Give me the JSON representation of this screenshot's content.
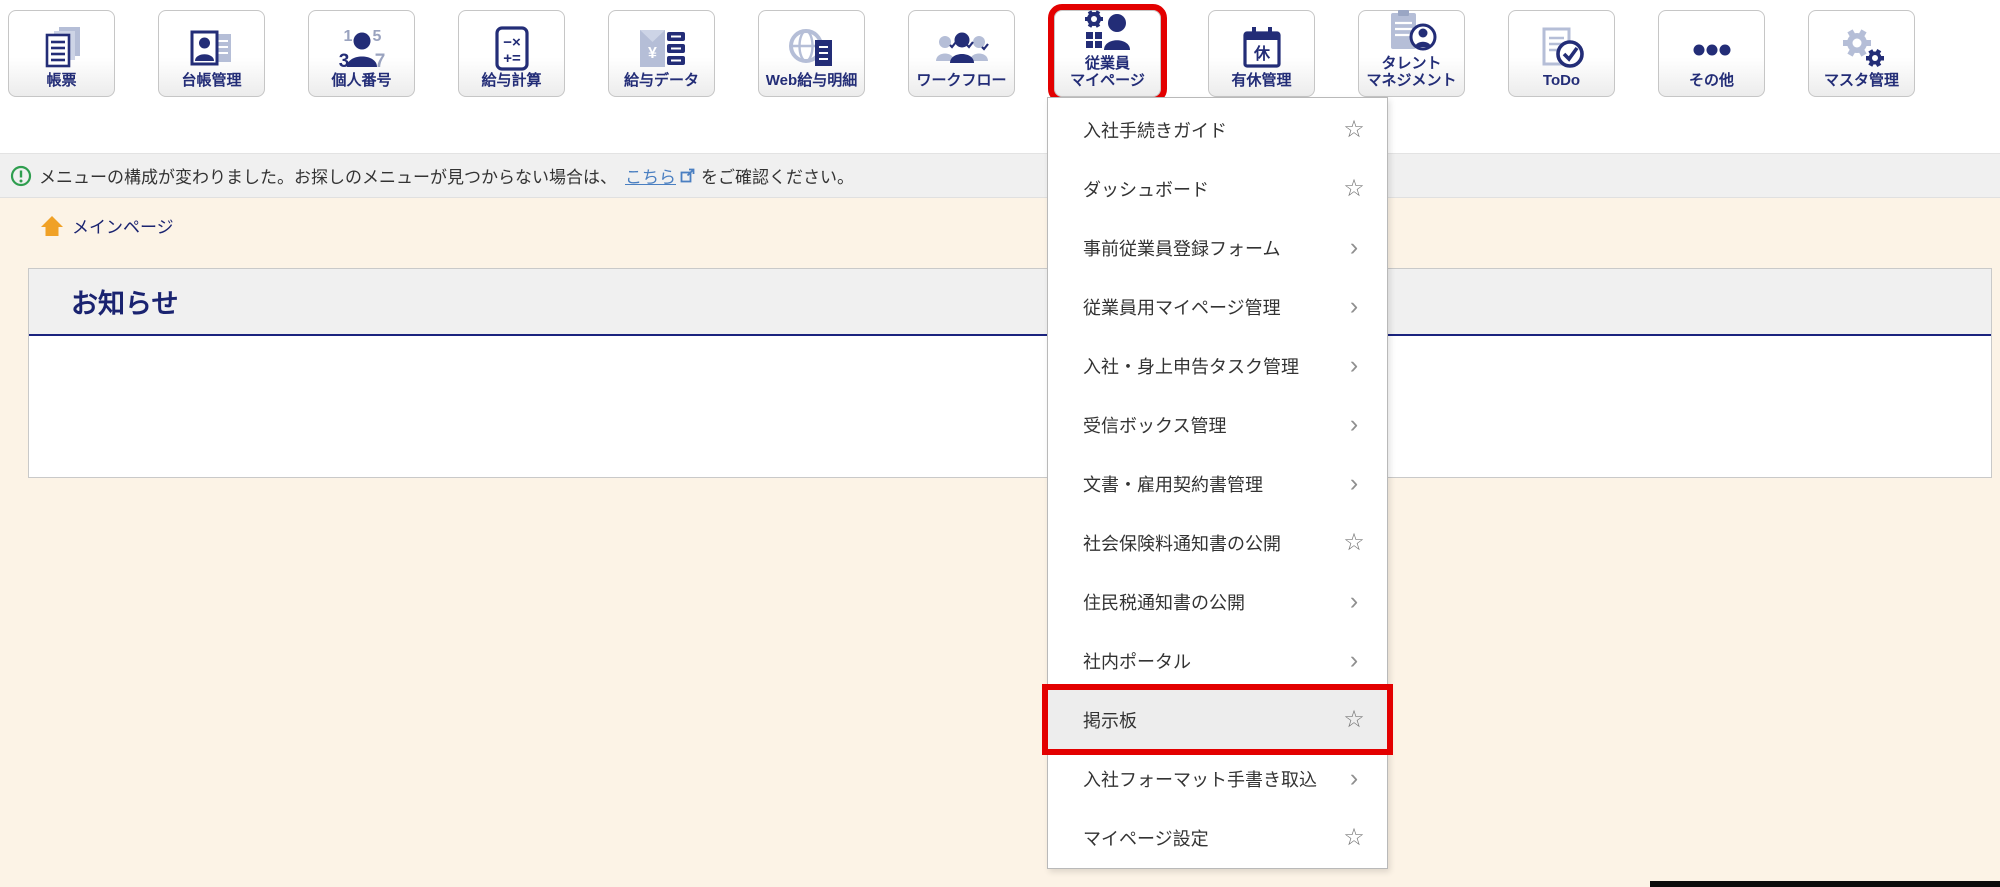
{
  "toolbar": {
    "buttons": [
      {
        "label": "帳票",
        "icon": "documents-icon"
      },
      {
        "label": "台帳管理",
        "icon": "ledger-icon"
      },
      {
        "label": "個人番号",
        "icon": "my-number-icon"
      },
      {
        "label": "給与計算",
        "icon": "calculator-icon"
      },
      {
        "label": "給与データ",
        "icon": "payroll-data-icon"
      },
      {
        "label": "Web給与明細",
        "icon": "web-payslip-icon"
      },
      {
        "label": "ワークフロー",
        "icon": "workflow-icon"
      },
      {
        "label": "従業員\nマイページ",
        "icon": "employee-mypage-icon",
        "selected": true
      },
      {
        "label": "有休管理",
        "icon": "leave-calendar-icon"
      },
      {
        "label": "タレント\nマネジメント",
        "icon": "talent-icon"
      },
      {
        "label": "ToDo",
        "icon": "todo-icon"
      },
      {
        "label": "その他",
        "icon": "more-dots-icon"
      },
      {
        "label": "マスタ管理",
        "icon": "master-gear-icon"
      }
    ]
  },
  "notification": {
    "text_before_link": "メニューの構成が変わりました。お探しのメニューが見つからない場合は、",
    "link_label": "こちら",
    "text_after_link": "をご確認ください。"
  },
  "breadcrumb": {
    "label": "メインページ"
  },
  "main": {
    "section_title": "お知らせ"
  },
  "dropdown": {
    "items": [
      {
        "label": "入社手続きガイド",
        "trailing_glyph": "☆",
        "type": "favorite"
      },
      {
        "label": "ダッシュボード",
        "trailing_glyph": "☆",
        "type": "favorite"
      },
      {
        "label": "事前従業員登録フォーム",
        "trailing_glyph": "›",
        "type": "submenu"
      },
      {
        "label": "従業員用マイページ管理",
        "trailing_glyph": "›",
        "type": "submenu"
      },
      {
        "label": "入社・身上申告タスク管理",
        "trailing_glyph": "›",
        "type": "submenu"
      },
      {
        "label": "受信ボックス管理",
        "trailing_glyph": "›",
        "type": "submenu"
      },
      {
        "label": "文書・雇用契約書管理",
        "trailing_glyph": "›",
        "type": "submenu"
      },
      {
        "label": "社会保険料通知書の公開",
        "trailing_glyph": "☆",
        "type": "favorite"
      },
      {
        "label": "住民税通知書の公開",
        "trailing_glyph": "›",
        "type": "submenu"
      },
      {
        "label": "社内ポータル",
        "trailing_glyph": "›",
        "type": "submenu"
      },
      {
        "label": "掲示板",
        "trailing_glyph": "☆",
        "type": "favorite",
        "highlighted": true
      },
      {
        "label": "入社フォーマット手書き取込",
        "trailing_glyph": "›",
        "type": "submenu"
      },
      {
        "label": "マイページ設定",
        "trailing_glyph": "☆",
        "type": "favorite"
      }
    ]
  },
  "colors": {
    "navy": "#232d77",
    "icon_gray_blue": "#b5bed7",
    "cream_background": "#fcf3e6",
    "highlight_red": "#e30000",
    "link_blue": "#4a7fc1",
    "info_green": "#2f9e4f",
    "header_navy_line": "#1a237e"
  }
}
